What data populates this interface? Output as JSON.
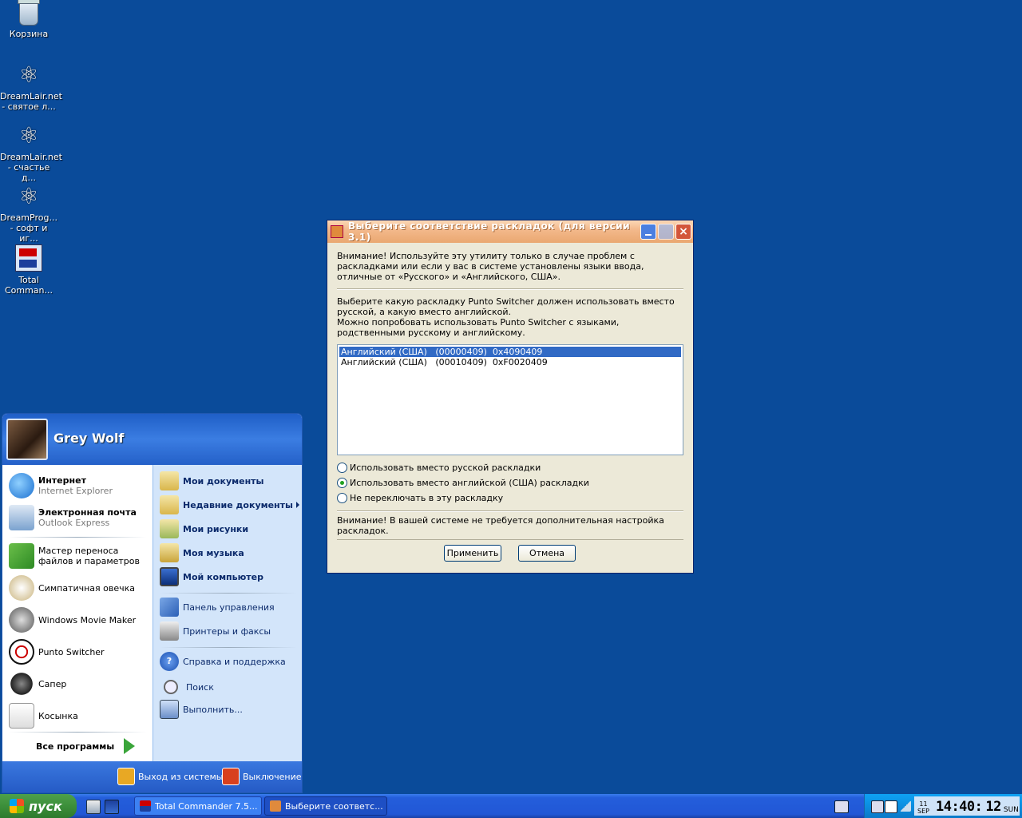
{
  "desktop": {
    "icons": [
      {
        "name": "recycle-bin",
        "line1": "Корзина",
        "line2": ""
      },
      {
        "name": "dreamlair-1",
        "line1": "DreamLair.net",
        "line2": "- святое л..."
      },
      {
        "name": "dreamlair-2",
        "line1": "DreamLair.net",
        "line2": "- счастье д..."
      },
      {
        "name": "dreamprog",
        "line1": "DreamProg...",
        "line2": "- софт и иг..."
      },
      {
        "name": "total-commander",
        "line1": "Total",
        "line2": "Comman..."
      }
    ]
  },
  "dialog": {
    "title": "Выберите соответствие раскладок (для версии 3.1)",
    "warning1": "Внимание! Используйте эту утилиту только в случае проблем с раскладками или если у вас в системе установлены языки ввода, отличные от «Русского» и «Английского, США».",
    "instruction": "Выберите какую раскладку Punto Switcher должен использовать вместо русской, а какую вместо английской.",
    "instruction2": "Можно попробовать использовать Punto Switcher с языками, родственными русскому и английскому.",
    "list": [
      "Английский (США)   (00000409)  0x4090409",
      "Английский (США)   (00010409)  0xF0020409"
    ],
    "radios": [
      "Использовать вместо русской раскладки",
      "Использовать вместо английской (США) раскладки",
      "Не переключать в эту раскладку"
    ],
    "selected_radio": 1,
    "status": "Внимание! В вашей системе не требуется дополнительная настройка раскладок.",
    "apply_label": "Применить",
    "cancel_label": "Отмена"
  },
  "start_menu": {
    "user": "Grey Wolf",
    "pinned": [
      {
        "title": "Интернет",
        "sub": "Internet Explorer"
      },
      {
        "title": "Электронная почта",
        "sub": "Outlook Express"
      }
    ],
    "recent": [
      "Мастер переноса файлов и параметров",
      "Симпатичная овечка",
      "Windows Movie Maker",
      "Punto Switcher",
      "Сапер",
      "Косынка"
    ],
    "all_programs": "Все программы",
    "right": [
      {
        "label": "Мои документы",
        "bold": true
      },
      {
        "label": "Недавние документы",
        "bold": true
      },
      {
        "label": "Мои рисунки",
        "bold": true
      },
      {
        "label": "Моя музыка",
        "bold": true
      },
      {
        "label": "Мой компьютер",
        "bold": true
      },
      {
        "label": "Панель управления",
        "bold": false
      },
      {
        "label": "Принтеры и факсы",
        "bold": false
      },
      {
        "label": "Справка и поддержка",
        "bold": false
      },
      {
        "label": "Поиск",
        "bold": false
      },
      {
        "label": "Выполнить...",
        "bold": false
      }
    ],
    "logoff": "Выход из системы",
    "shutdown": "Выключение"
  },
  "taskbar": {
    "start_label": "пуск",
    "tasks": [
      "Total Commander 7.5...",
      "Выберите соответс..."
    ],
    "clock": {
      "day_num": "11",
      "month": "SEP",
      "time": "14:40:",
      "sec": "12",
      "weekday": "SUN"
    }
  }
}
